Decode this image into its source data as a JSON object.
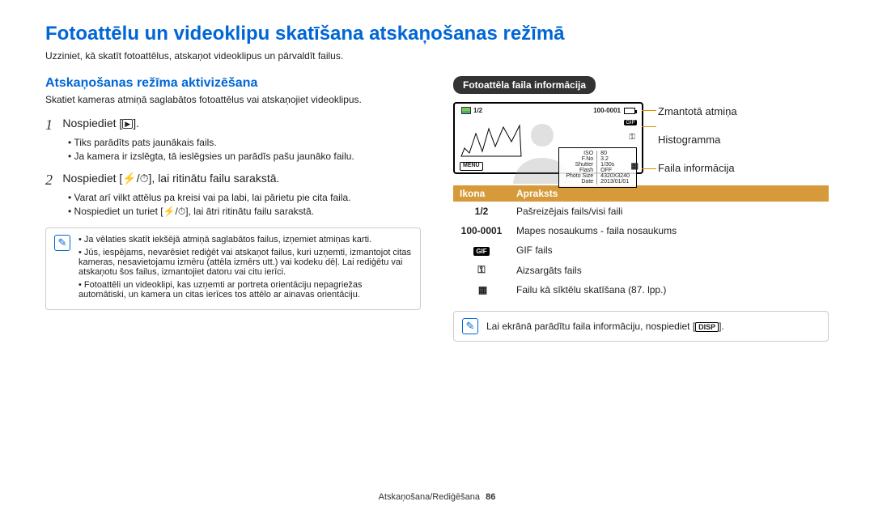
{
  "title": "Fotoattēlu un videoklipu skatīšana atskaņošanas režīmā",
  "intro": "Uzziniet, kā skatīt fotoattēlus, atskaņot videoklipus un pārvaldīt failus.",
  "left": {
    "subhead": "Atskaņošanas režīma aktivizēšana",
    "subtext": "Skatiet kameras atmiņā saglabātos fotoattēlus vai atskaņojiet videoklipus.",
    "step1_num": "1",
    "step1_a": "Nospiediet [",
    "step1_icon": "▶",
    "step1_b": "].",
    "step1_bullets": [
      "Tiks parādīts pats jaunākais fails.",
      "Ja kamera ir izslēgta, tā ieslēgsies un parādīs pašu jaunāko failu."
    ],
    "step2_num": "2",
    "step2_a": "Nospiediet [",
    "step2_icon1": "⚡",
    "step2_slash": "/",
    "step2_icon2": "⏱",
    "step2_b": "], lai ritinātu failu sarakstā.",
    "step2_bullets": [
      "Varat arī vilkt attēlus pa kreisi vai pa labi, lai pārietu pie cita faila.",
      "Nospiediet un turiet [⚡/⏱], lai ātri ritinātu failu sarakstā."
    ],
    "info": [
      "Ja vēlaties skatīt iekšējā atmiņā saglabātos failus, izņemiet atmiņas karti.",
      "Jūs, iespējams, nevarēsiet rediģēt vai atskaņot failus, kuri uzņemti, izmantojot citas kameras, nesavietojamu izmēru (attēla izmērs utt.) vai kodeku dēļ. Lai rediģētu vai atskaņotu šos failus, izmantojiet datoru vai citu ierīci.",
      "Fotoattēli un videoklipi, kas uzņemti ar portreta orientāciju nepagriežas automātiski, un kamera un citas ierīces tos attēlo ar ainavas orientāciju."
    ]
  },
  "right": {
    "pill": "Fotoattēla faila informācija",
    "lcd": {
      "topleft_count": "1/2",
      "topright_folder": "100-0001",
      "gif": "GIF",
      "menu": "MENU",
      "info_rows": [
        [
          "ISO",
          "80"
        ],
        [
          "F.No",
          "3.2"
        ],
        [
          "Shutter",
          "1/30s"
        ],
        [
          "Flash",
          "OFF"
        ],
        [
          "Photo Size",
          "4320X3240"
        ],
        [
          "Date",
          "2013/01/01"
        ]
      ]
    },
    "callouts": {
      "mem": "Zmantotā atmiņa",
      "histo": "Histogramma",
      "finfo": "Faila informācija"
    },
    "table_head_icon": "Ikona",
    "table_head_desc": "Apraksts",
    "rows": [
      {
        "icon": "1/2",
        "desc": "Pašreizējais fails/visi faili"
      },
      {
        "icon": "100-0001",
        "desc": "Mapes nosaukums - faila nosaukums"
      },
      {
        "icon": "GIF",
        "desc": "GIF fails"
      },
      {
        "icon": "KEY",
        "desc": "Aizsargāts fails"
      },
      {
        "icon": "THUMB",
        "desc": "Failu kā sīktēlu skatīšana (87. lpp.)"
      }
    ],
    "tip_a": "Lai ekrānā parādītu faila informāciju, nospiediet [",
    "tip_btn": "DISP",
    "tip_b": "]."
  },
  "footer_a": "Atskaņošana/Rediģēšana",
  "footer_b": "86"
}
